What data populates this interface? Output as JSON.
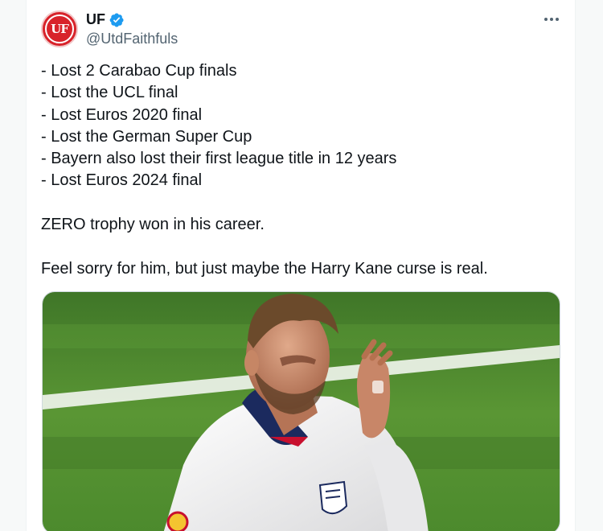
{
  "tweet": {
    "author": {
      "display_name": "UF",
      "handle": "@UtdFaithfuls",
      "avatar_text": "UF",
      "verified": true
    },
    "lines": [
      "- Lost 2 Carabao Cup finals",
      "- Lost the UCL final",
      "- Lost Euros 2020 final",
      "- Lost the German Super Cup",
      "- Bayern also lost their first league title in 12 years",
      "- Lost Euros 2024 final",
      "",
      "ZERO trophy won in his career.",
      "",
      "Feel sorry for him, but just maybe the Harry Kane curse is  real."
    ],
    "media": {
      "description_icon": "photo",
      "colors": {
        "pitch": "#4f8a2e",
        "shirt": "#f3f3f3",
        "collar": "#1b2a5e"
      }
    }
  },
  "colors": {
    "text": "#0f1419",
    "secondary": "#536471",
    "verified_blue": "#1d9bf0",
    "avatar_red": "#d8232a"
  }
}
